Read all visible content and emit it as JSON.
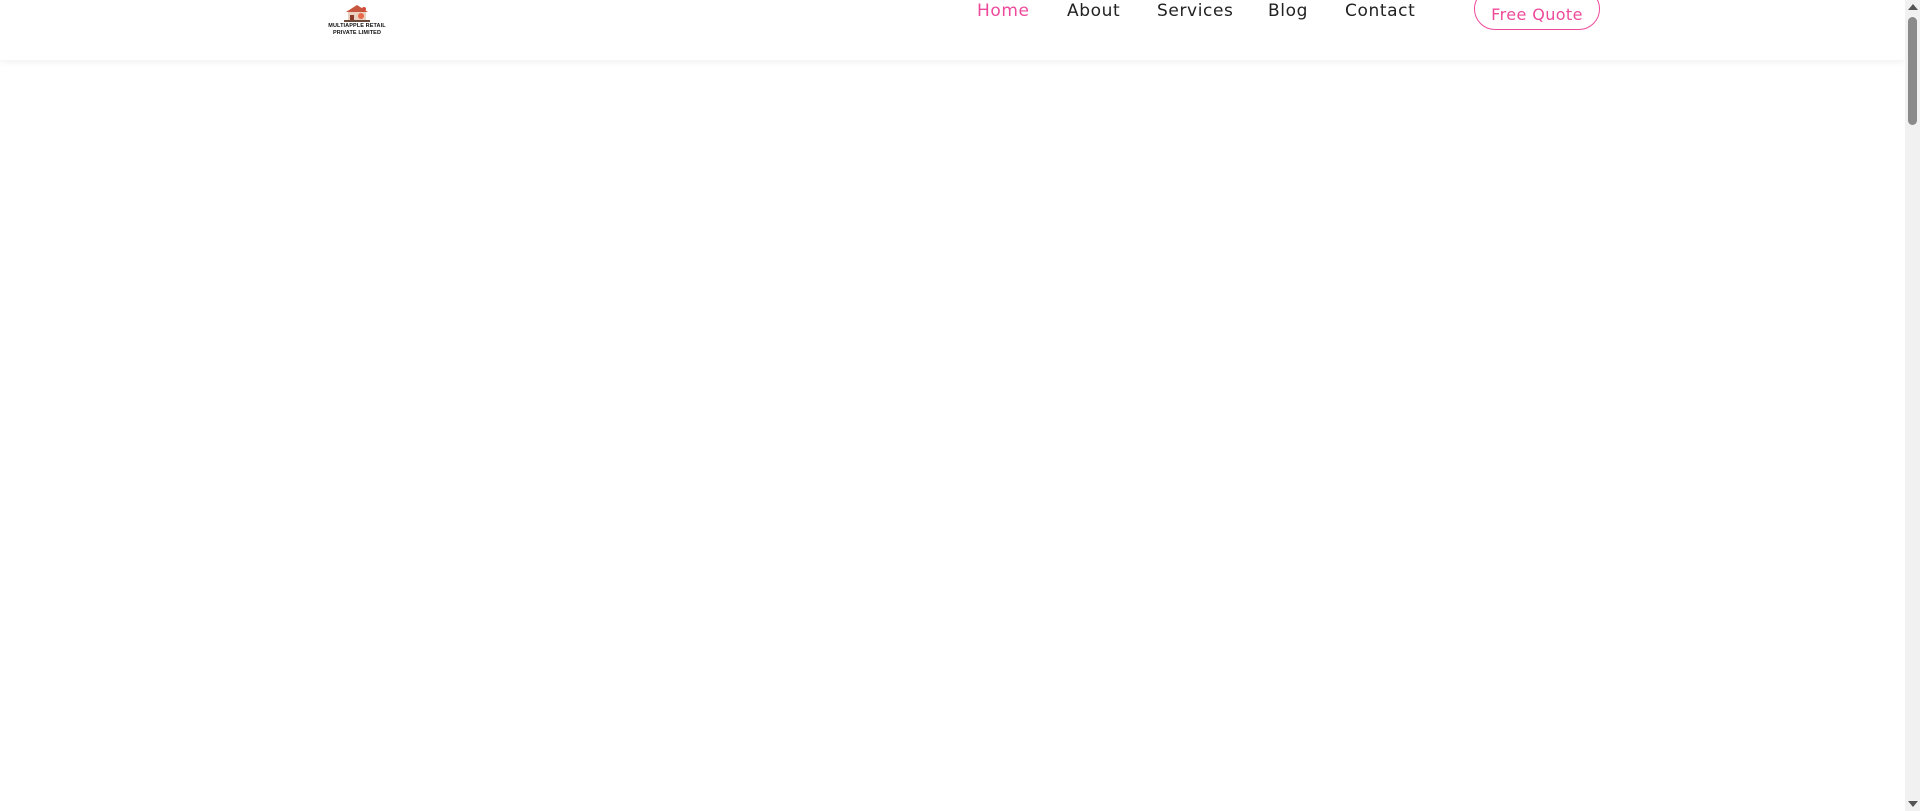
{
  "brand": {
    "logo_text": "MULTIAPPLE RETAIL PRIVATE LIMITED",
    "logo_icon": "storefront-logo-icon"
  },
  "nav": {
    "items": [
      {
        "label": "Home",
        "active": true
      },
      {
        "label": "About",
        "active": false
      },
      {
        "label": "Services",
        "active": false
      },
      {
        "label": "Blog",
        "active": false
      },
      {
        "label": "Contact",
        "active": false
      }
    ],
    "cta_label": "Free Quote"
  },
  "colors": {
    "accent": "#ee4a9b",
    "text": "#222222",
    "background": "#ffffff"
  }
}
